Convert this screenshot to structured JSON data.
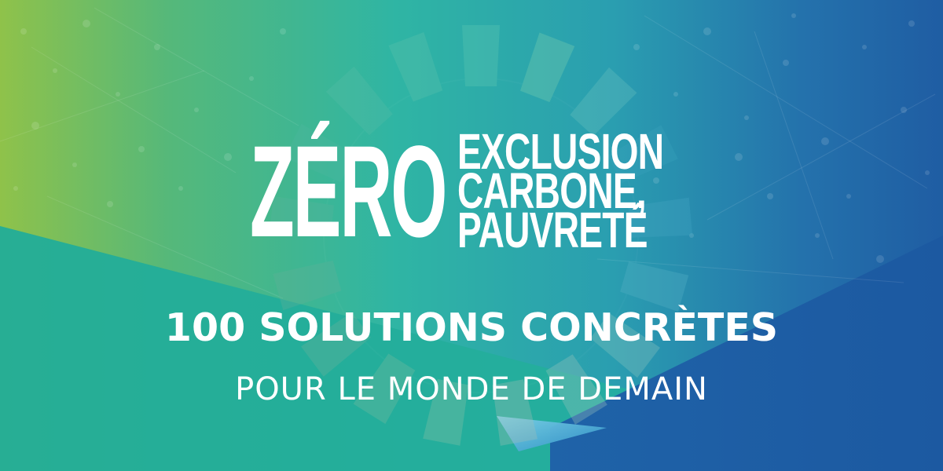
{
  "banner": {
    "headline_word": "ZÉRO",
    "headline_topics": [
      "EXCLUSION",
      "CARBONE,",
      "PAUVRETÉ"
    ],
    "tagline": "100 SOLUTIONS CONCRÈTES",
    "subtagline": "POUR LE MONDE DE DEMAIN"
  },
  "colors": {
    "gradient_left": "#8fc24a",
    "gradient_mid": "#2fb5a4",
    "gradient_right": "#1f5da3",
    "teal_panel": "#23ad9e",
    "blue_panel": "#1d5fa4",
    "text": "#ffffff"
  },
  "decor": {
    "emblem": "sdg-color-wheel-icon"
  }
}
